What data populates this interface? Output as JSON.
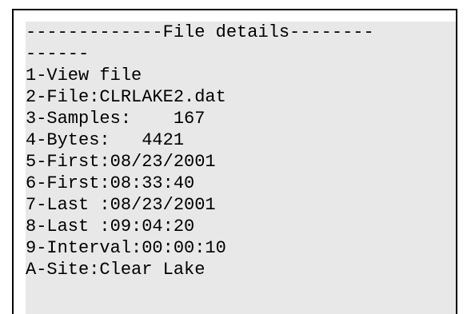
{
  "screen": {
    "lines": [
      "-------------File details--------",
      "------",
      "1-View file",
      "2-File:CLRLAKE2.dat",
      "3-Samples:    167",
      "4-Bytes:   4421",
      "5-First:08/23/2001",
      "6-First:08:33:40",
      "7-Last :08/23/2001",
      "8-Last :09:04:20",
      "9-Interval:00:00:10",
      "A-Site:Clear Lake"
    ]
  },
  "colors": {
    "screen_background": "#e8e8e8",
    "text": "#000000",
    "frame": "#000000"
  }
}
